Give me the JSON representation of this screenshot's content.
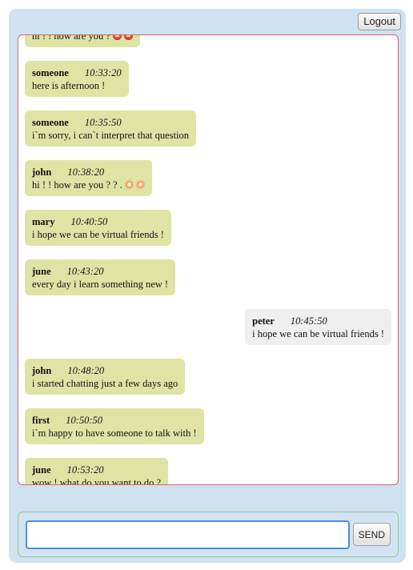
{
  "header": {
    "logout_label": "Logout"
  },
  "messages": [
    {
      "user": "",
      "time": "",
      "text": "hi ! ! how are you ?",
      "emojis": [
        "kiss-icon",
        "kiss-icon"
      ],
      "align": "left"
    },
    {
      "user": "someone",
      "time": "10:33:20",
      "text": "here is afternoon !",
      "emojis": [],
      "align": "left"
    },
    {
      "user": "someone",
      "time": "10:35:50",
      "text": "i`m sorry, i can`t interpret that question",
      "emojis": [],
      "align": "left"
    },
    {
      "user": "john",
      "time": "10:38:20",
      "text": "hi ! ! how are you ? ? .",
      "emojis": [
        "laugh-icon",
        "laugh-icon"
      ],
      "align": "left"
    },
    {
      "user": "mary",
      "time": "10:40:50",
      "text": "i hope we can be virtual friends !",
      "emojis": [],
      "align": "left"
    },
    {
      "user": "june",
      "time": "10:43:20",
      "text": "every day i learn something new !",
      "emojis": [],
      "align": "left"
    },
    {
      "user": "peter",
      "time": "10:45:50",
      "text": "i hope we can be virtual friends !",
      "emojis": [],
      "align": "right"
    },
    {
      "user": "john",
      "time": "10:48:20",
      "text": "i started chatting just a few days ago",
      "emojis": [],
      "align": "left"
    },
    {
      "user": "first",
      "time": "10:50:50",
      "text": "i`m happy to have someone to talk with !",
      "emojis": [],
      "align": "left"
    },
    {
      "user": "june",
      "time": "10:53:20",
      "text": "wow ! what do you want to do ?",
      "emojis": [],
      "align": "left"
    }
  ],
  "composer": {
    "value": "",
    "placeholder": "",
    "send_label": "SEND"
  },
  "colors": {
    "frame_bg": "#cfe2f1",
    "chat_border": "#d9646f",
    "bubble_other": "#dfe4a5",
    "bubble_self": "#efefef",
    "input_border": "#4a8fd9",
    "composer_border": "#8ec79a"
  }
}
